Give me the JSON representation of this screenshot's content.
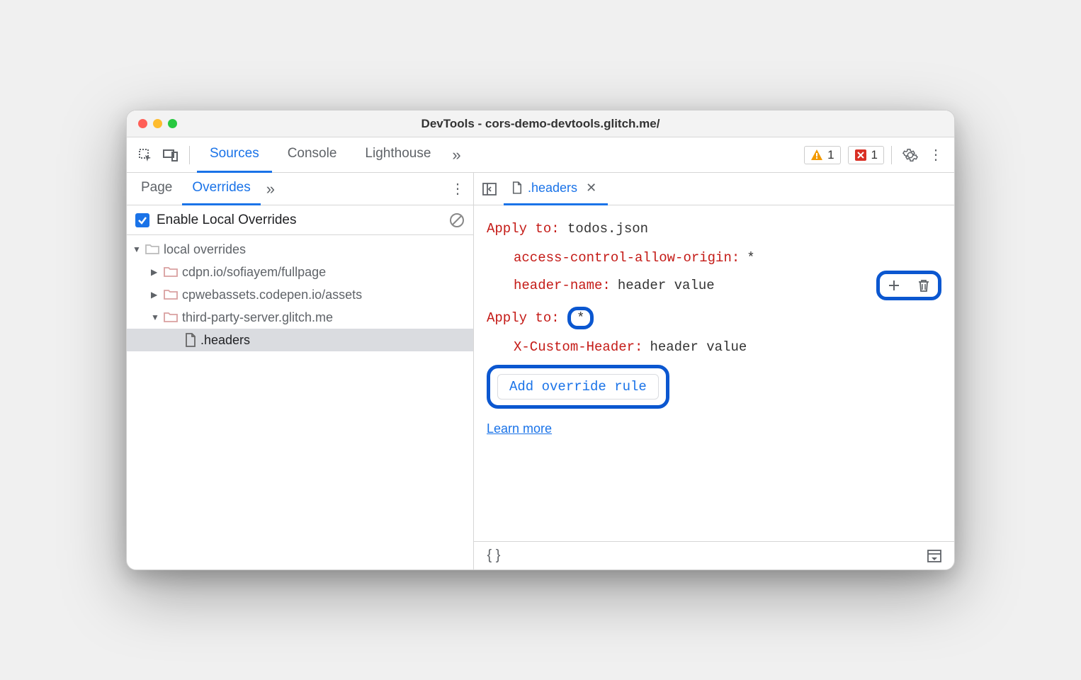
{
  "window": {
    "title": "DevTools - cors-demo-devtools.glitch.me/"
  },
  "toolbar": {
    "tabs": [
      "Sources",
      "Console",
      "Lighthouse"
    ],
    "active": "Sources",
    "warn_count": "1",
    "error_count": "1"
  },
  "left": {
    "tabs": [
      "Page",
      "Overrides"
    ],
    "active": "Overrides",
    "enable_label": "Enable Local Overrides",
    "tree": {
      "root": "local overrides",
      "items": [
        "cdpn.io/sofiayem/fullpage",
        "cpwebassets.codepen.io/assets",
        "third-party-server.glitch.me"
      ],
      "file": ".headers"
    }
  },
  "file_tab": {
    "name": ".headers"
  },
  "editor": {
    "apply_label": "Apply to",
    "rules": [
      {
        "target": "todos.json",
        "headers": [
          {
            "name": "access-control-allow-origin",
            "value": "*"
          },
          {
            "name": "header-name",
            "value": "header value"
          }
        ]
      },
      {
        "target": "*",
        "headers": [
          {
            "name": "X-Custom-Header",
            "value": "header value"
          }
        ]
      }
    ],
    "add_rule": "Add override rule",
    "learn_more": "Learn more"
  }
}
